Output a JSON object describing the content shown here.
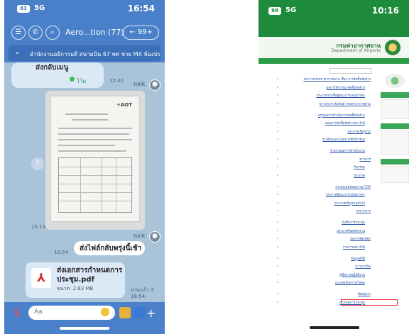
{
  "left_phone": {
    "status": {
      "time": "16:54",
      "network": "5G",
      "battery": "83"
    },
    "header": {
      "back_label": "99+",
      "title": "Aero...tion (77)"
    },
    "banner": {
      "text": "อำนักงานอธิการบดี สนามบิน 67 พศ ช่วย MX ห้องประชุม..."
    },
    "messages": [
      {
        "text": "ส่งกลับเมนู",
        "tag": "ไว้ผ",
        "time": "12:40"
      },
      {
        "sender": "nick",
        "time": "15:13"
      },
      {
        "sender": "nick",
        "text": "ส่งไฟล์กลับพรุ่งนี้เช้า",
        "time": "16:54"
      }
    ],
    "file": {
      "name_line1": "ส่งเอกสารกำหนดการ",
      "name_line2": "ประชุม.pdf",
      "meta": "ขนาด: 2.83 MB",
      "time": "16:54",
      "read": "อ่านแล้ว 3"
    },
    "input": {
      "placeholder": "Aa"
    }
  },
  "right_phone": {
    "status": {
      "time": "10:16",
      "network": "5G",
      "battery": "88"
    },
    "site": {
      "brand": "กรมท่าอากาศยาน",
      "brand_sub": "Department of Airports"
    },
    "links": [
      "ประกาศกรมท่าอากาศยาน เรื่อง การจัดซื้อจัดจ้าง",
      "ผลการพิจารณาจัดซื้อจัดจ้าง",
      "ประกาศรายชื่อผู้ชนะการเสนอราคา",
      "ข่าวประชาสัมพันธ์ กรมท่าอากาศยาน",
      "สรุปผลการดำเนินการจัดซื้อจัดจ้าง",
      "แผนการจัดซื้อจัดจ้างประจำปี",
      "ประกาศเชิญชวน",
      "ระเบียบและกฎหมายที่เกี่ยวข้อง",
      "รายงานผลการดำเนินงาน",
      "ข่าวสาร",
      "กิจกรรม",
      "ประกาศ",
      "ร่างขอบเขตของงาน TOR",
      "ประกาศผู้ชนะการเสนอราคา",
      "ประกาศเชิญชวนทั่วไป",
      "ราคากลาง",
      "บันทึกการประชุม",
      "ประกาศรับสมัครงาน",
      "ผลการคัดเลือก",
      "รายงานประจำปี",
      "ข้อมูลสถิติ",
      "ข่าวการบิน",
      "คู่มือการปฏิบัติงาน",
      "แบบฟอร์มดาวน์โหลด",
      "ติดต่อเรา",
      "กำหนดการประชุม"
    ]
  }
}
